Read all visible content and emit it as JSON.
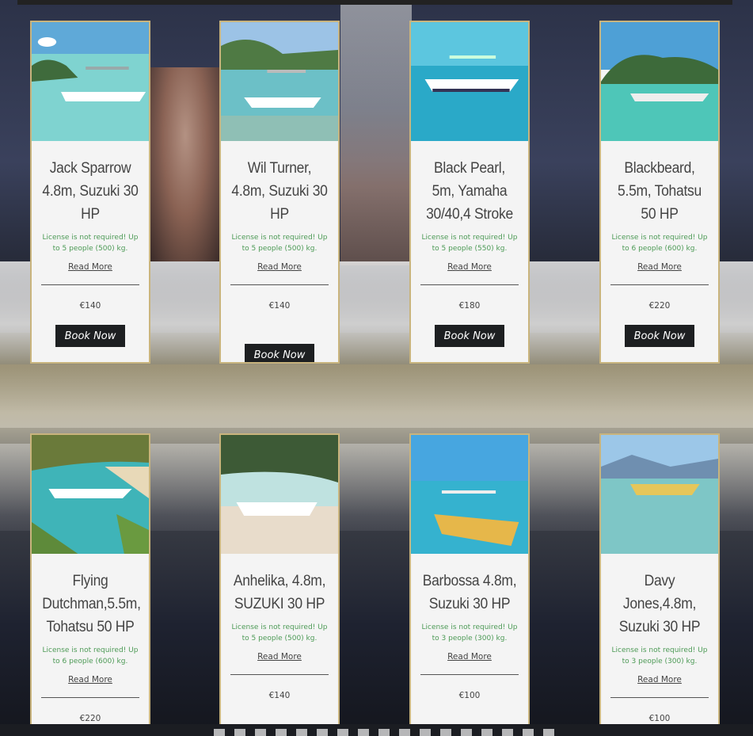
{
  "colors": {
    "card_border": "#c9b47d",
    "license_green": "#4d9a56",
    "button_bg": "#1d1f21"
  },
  "boats": [
    {
      "title": "Jack Sparrow 4.8m, Suzuki 30 HP",
      "license": "License is not required! Up to 5 people (500) kg.",
      "read_more": "Read More",
      "price": "€140",
      "book": "Book Now"
    },
    {
      "title": "Wil Turner, 4.8m, Suzuki 30 HP",
      "license": "License is not required! Up to 5 people (500) kg.",
      "read_more": "Read More",
      "price": "€140",
      "book": "Book Now"
    },
    {
      "title": "Black Pearl, 5m, Yamaha 30/40,4 Stroke",
      "license": "License is not required! Up to 5 people (550) kg.",
      "read_more": "Read More",
      "price": "€180",
      "book": "Book Now"
    },
    {
      "title": "Blackbeard, 5.5m, Tohatsu 50 HP",
      "license": "License is not required! Up to 6 people (600) kg.",
      "read_more": "Read More",
      "price": "€220",
      "book": "Book Now"
    },
    {
      "title": "Flying Dutchman,5.5m, Tohatsu 50 HP",
      "license": "License is not required! Up to 6 people (600) kg.",
      "read_more": "Read More",
      "price": "€220"
    },
    {
      "title": "Anhelika, 4.8m, SUZUKI 30 HP",
      "license": "License is not required! Up to 5 people (500) kg.",
      "read_more": "Read More",
      "price": "€140"
    },
    {
      "title": "Barbossa 4.8m, Suzuki 30 HP",
      "license": "License is not required! Up to 3 people (300) kg.",
      "read_more": "Read More",
      "price": "€100"
    },
    {
      "title": "Davy Jones,4.8m, Suzuki 30 HP",
      "license": "License is not required! Up to 3 people (300) kg.",
      "read_more": "Read More",
      "price": "€100"
    }
  ]
}
